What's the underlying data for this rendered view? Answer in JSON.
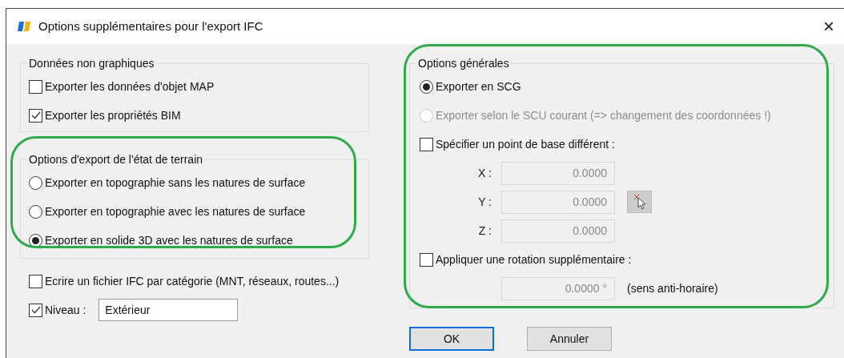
{
  "window": {
    "title": "Options supplémentaires pour l'export IFC",
    "close": "×"
  },
  "non_graphic_data": {
    "title": "Données non graphiques",
    "checkboxes": [
      {
        "label": "Exporter les données d'objet MAP",
        "checked": false
      },
      {
        "label": "Exporter les propriétés BIM",
        "checked": true
      }
    ]
  },
  "terrain_export": {
    "title": "Options d'export de l'état de terrain",
    "highlighted": true,
    "options": [
      {
        "label": "Exporter en topographie sans les natures de surface",
        "selected": false
      },
      {
        "label": "Exporter en topographie avec les natures de surface",
        "selected": false
      },
      {
        "label": "Exporter en solide 3D avec les natures de surface",
        "selected": true
      }
    ]
  },
  "file_per_category": {
    "label": "Ecrire un fichier IFC par catégorie (MNT, réseaux, routes...)",
    "checked": false
  },
  "level": {
    "label": "Niveau :",
    "checked": true,
    "value": "Extérieur"
  },
  "general_options": {
    "title": "Options générales",
    "highlighted": true,
    "coordinate_options": [
      {
        "label": "Exporter en SCG",
        "selected": true,
        "disabled": false
      },
      {
        "label": "Exporter selon le SCU courant (=> changement des coordonnées !)",
        "selected": false,
        "disabled": true
      }
    ],
    "base_point": {
      "label": "Spécifier un point de base différent :",
      "checked": false,
      "fields": [
        {
          "label": "X :",
          "value": "0.0000",
          "disabled": true
        },
        {
          "label": "Y :",
          "value": "0.0000",
          "disabled": true
        },
        {
          "label": "Z :",
          "value": "0.0000",
          "disabled": true
        }
      ]
    },
    "rotation": {
      "label": "Appliquer une rotation supplémentaire :",
      "checked": false,
      "value": "0.0000 °",
      "disabled": true,
      "note": "(sens anti-horaire)"
    }
  },
  "buttons": [
    {
      "label": "OK",
      "default": true
    },
    {
      "label": "Annuler",
      "default": false
    }
  ]
}
